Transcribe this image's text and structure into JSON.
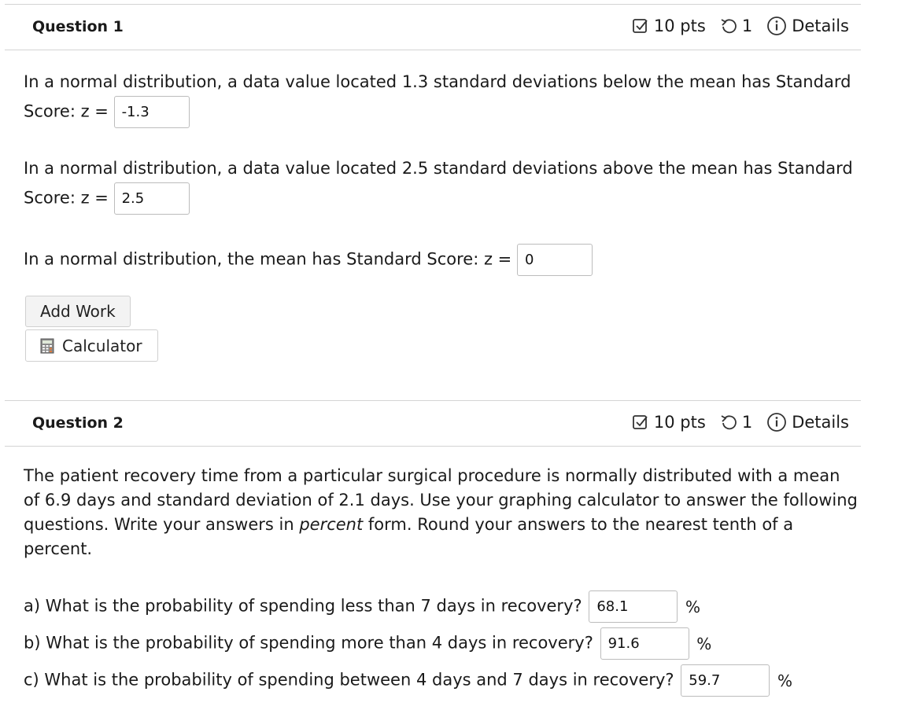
{
  "question1": {
    "title": "Question 1",
    "points": "10 pts",
    "attempts": "1",
    "details": "Details",
    "part1_text_a": "In a normal distribution, a data value located 1.3 standard deviations below the mean has Standard",
    "part1_text_b": "Score: z =",
    "part1_value": "-1.3",
    "part2_text_a": "In a normal distribution, a data value located 2.5 standard deviations above the mean has Standard",
    "part2_text_b": "Score: z =",
    "part2_value": "2.5",
    "part3_text": "In a normal distribution, the mean has Standard Score: z =",
    "part3_value": "0",
    "add_work": "Add Work",
    "calculator": "Calculator"
  },
  "question2": {
    "title": "Question 2",
    "points": "10 pts",
    "attempts": "1",
    "details": "Details",
    "intro_1": "The patient recovery time from a particular surgical procedure is normally distributed with a mean",
    "intro_2": "of 6.9 days and standard deviation of 2.1 days. Use your graphing calculator to answer the following",
    "intro_3a": "questions. Write your answers in ",
    "intro_3_em": "percent",
    "intro_3b": " form. Round your answers to the nearest tenth of a",
    "intro_4": "percent.",
    "a_text": "a) What is the probability of spending less than 7 days in recovery?",
    "a_value": "68.1",
    "b_text": "b) What is the probability of spending more than 4 days in recovery?",
    "b_value": "91.6",
    "c_text": "c) What is the probability of spending between 4 days and 7 days in recovery?",
    "c_value": "59.7",
    "percent": "%"
  },
  "icons": {
    "points": "checkbox-check-icon",
    "attempts": "retry-icon",
    "details": "info-icon",
    "calculator": "calculator-icon"
  }
}
